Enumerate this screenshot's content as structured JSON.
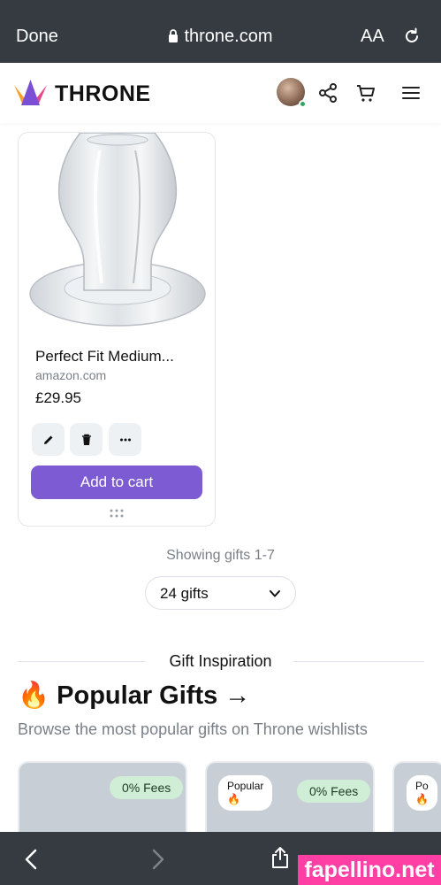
{
  "browser": {
    "done_label": "Done",
    "url": "throne.com",
    "text_size_label": "AA"
  },
  "header": {
    "brand": "THRONE"
  },
  "product": {
    "title": "Perfect Fit Medium...",
    "source": "amazon.com",
    "price": "£29.95",
    "add_to_cart_label": "Add to cart"
  },
  "pagination": {
    "showing": "Showing gifts 1-7",
    "page_size": "24 gifts"
  },
  "inspiration": {
    "section_label": "Gift Inspiration",
    "title": "🔥 Popular Gifts →",
    "subtitle": "Browse the most popular gifts on Throne wishlists",
    "cards": [
      {
        "fees": "0% Fees"
      },
      {
        "popular_line1": "Popular",
        "popular_line2": "🔥",
        "fees": "0% Fees"
      },
      {
        "popular_line1": "Po",
        "popular_line2": "🔥"
      }
    ]
  },
  "watermark": "fapellino.net",
  "colors": {
    "browser_chrome": "#353b40",
    "accent_purple": "#7d5bd3",
    "fees_green": "#cfeed5",
    "online_green": "#2fa85e",
    "watermark_pink": "#ff3fa4"
  },
  "icons": [
    "lock-icon",
    "reload-icon",
    "share-icon",
    "cart-icon",
    "menu-icon",
    "edit-icon",
    "trash-icon",
    "more-icon",
    "drag-handle-icon",
    "chevron-down-icon",
    "back-icon",
    "forward-icon",
    "share-sheet-icon"
  ]
}
